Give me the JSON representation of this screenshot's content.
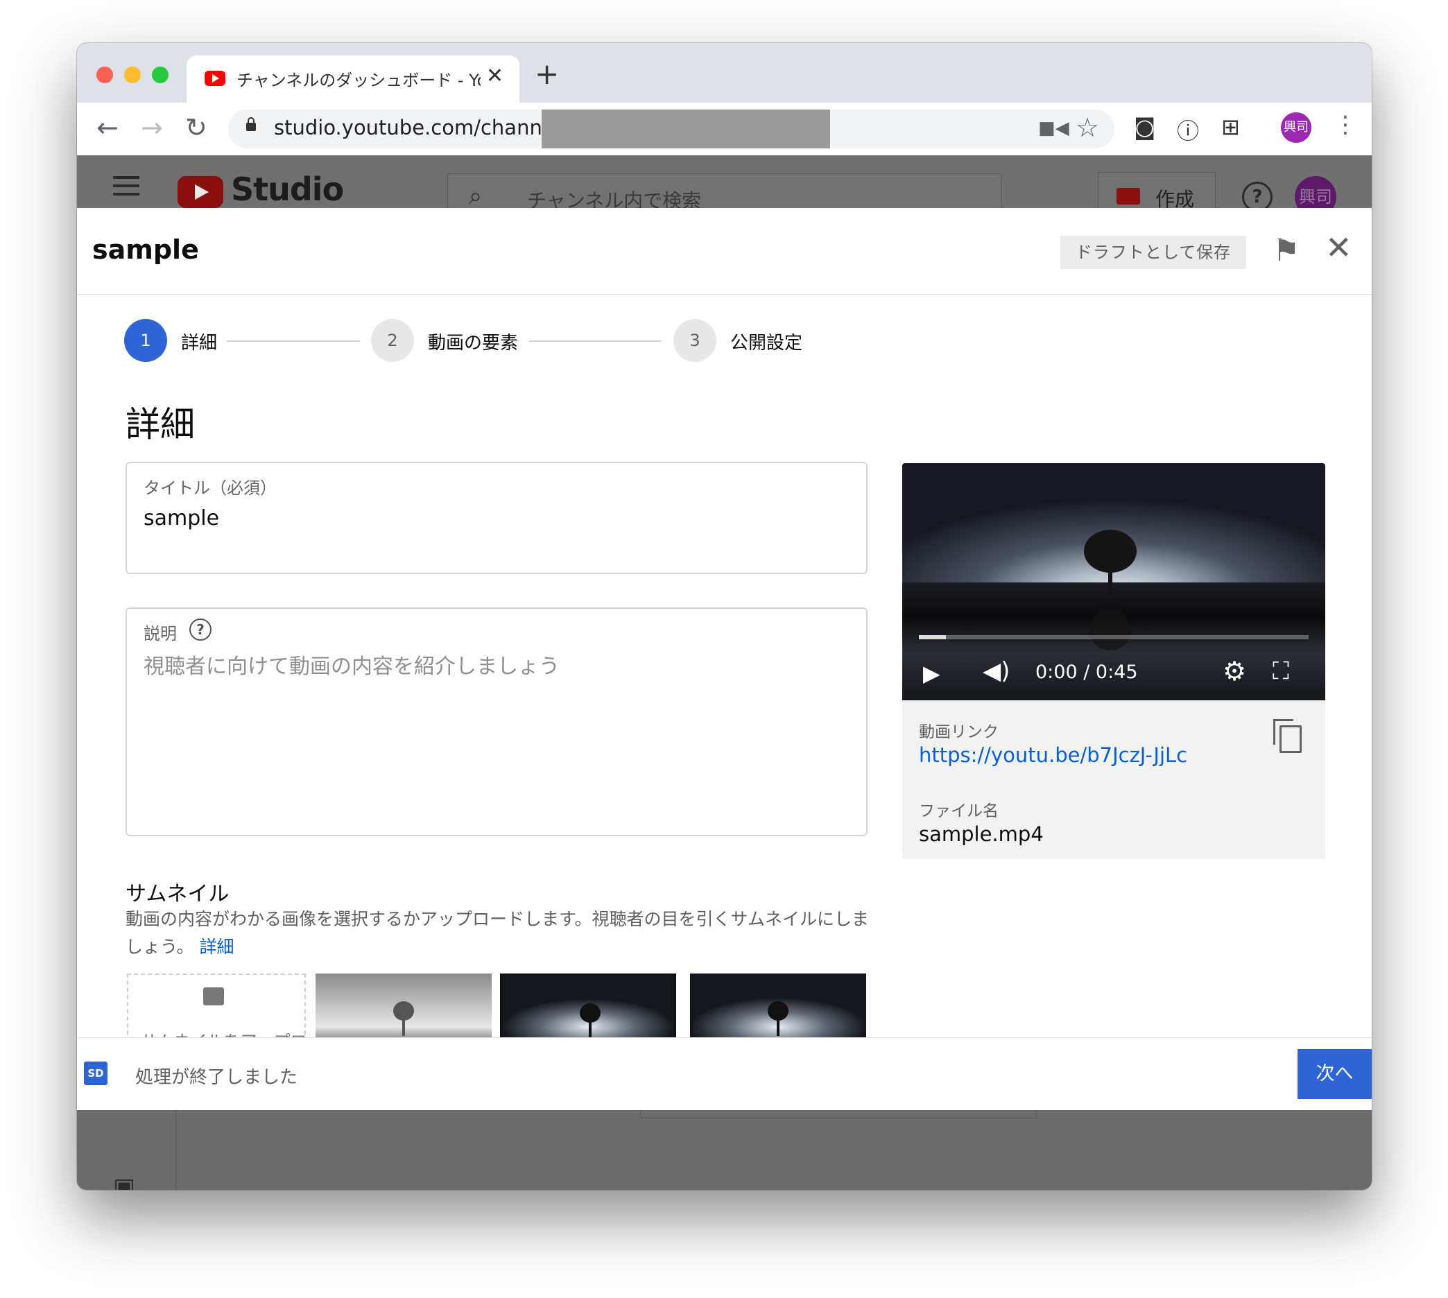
{
  "browser": {
    "tab_title": "チャンネルのダッシュボード - YouTube Studio",
    "url": "studio.youtube.com/channel/",
    "profile_initials": "興司"
  },
  "studio": {
    "logo_text": "Studio",
    "search_placeholder": "チャンネル内で検索",
    "create_label": "作成",
    "avatar_initials": "興司"
  },
  "modal": {
    "title": "sample",
    "save_draft_label": "ドラフトとして保存",
    "steps": [
      {
        "number": "1",
        "label": "詳細",
        "active": true
      },
      {
        "number": "2",
        "label": "動画の要素",
        "active": false
      },
      {
        "number": "3",
        "label": "公開設定",
        "active": false
      }
    ],
    "section_title": "詳細",
    "title_field": {
      "label": "タイトル（必須）",
      "value": "sample"
    },
    "description_field": {
      "label": "説明",
      "placeholder": "視聴者に向けて動画の内容を紹介しましょう"
    },
    "thumbnail": {
      "title": "サムネイル",
      "description": "動画の内容がわかる画像を選択するかアップロードします。視聴者の目を引くサムネイルにしましょう。",
      "learn_more": "詳細",
      "upload_label": "サムネイルをアップロード"
    },
    "video": {
      "time": "0:00 / 0:45",
      "progress": 0.07,
      "link_label": "動画リンク",
      "link": "https://youtu.be/b7JczJ-JjLc",
      "file_label": "ファイル名",
      "file_name": "sample.mp4"
    },
    "footer": {
      "badge": "SD",
      "status": "処理が終了しました",
      "next_label": "次へ"
    }
  }
}
